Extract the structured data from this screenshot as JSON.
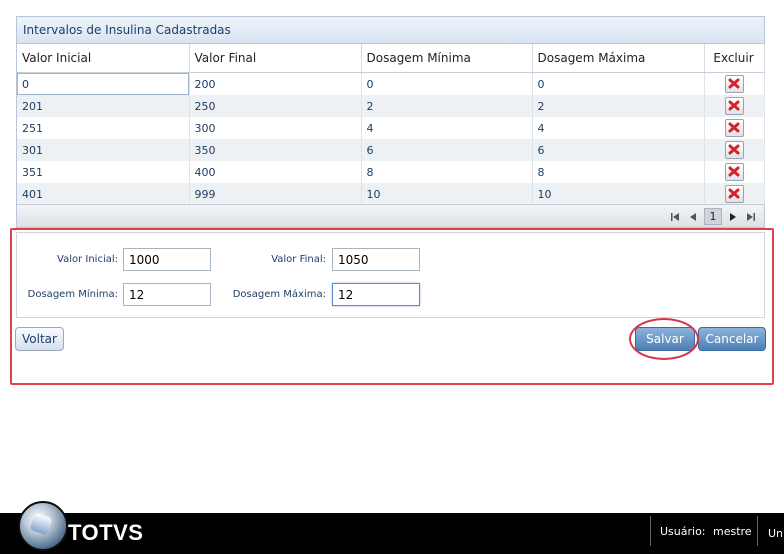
{
  "grid": {
    "title": "Intervalos de Insulina Cadastradas",
    "columns": [
      "Valor Inicial",
      "Valor Final",
      "Dosagem Mínima",
      "Dosagem Máxima",
      "Excluir"
    ],
    "rows": [
      [
        "0",
        "200",
        "0",
        "0"
      ],
      [
        "201",
        "250",
        "2",
        "2"
      ],
      [
        "251",
        "300",
        "4",
        "4"
      ],
      [
        "301",
        "350",
        "6",
        "6"
      ],
      [
        "351",
        "400",
        "8",
        "8"
      ],
      [
        "401",
        "999",
        "10",
        "10"
      ]
    ],
    "pager": {
      "current_page": "1"
    }
  },
  "form": {
    "valor_inicial_label": "Valor Inicial:",
    "valor_inicial_value": "1000",
    "valor_final_label": "Valor Final:",
    "valor_final_value": "1050",
    "dosagem_minima_label": "Dosagem Mínima:",
    "dosagem_minima_value": "12",
    "dosagem_maxima_label": "Dosagem Máxima:",
    "dosagem_maxima_value": "12"
  },
  "buttons": {
    "voltar": "Voltar",
    "salvar": "Salvar",
    "cancelar": "Cancelar"
  },
  "footer": {
    "brand": "TOTVS",
    "user_label": "Usuário:",
    "user_value": "mestre",
    "truncated": "Un"
  },
  "colors": {
    "annotation": "#e24049",
    "accent": "#4d7fb5",
    "delete_icon": "#d4232b"
  }
}
